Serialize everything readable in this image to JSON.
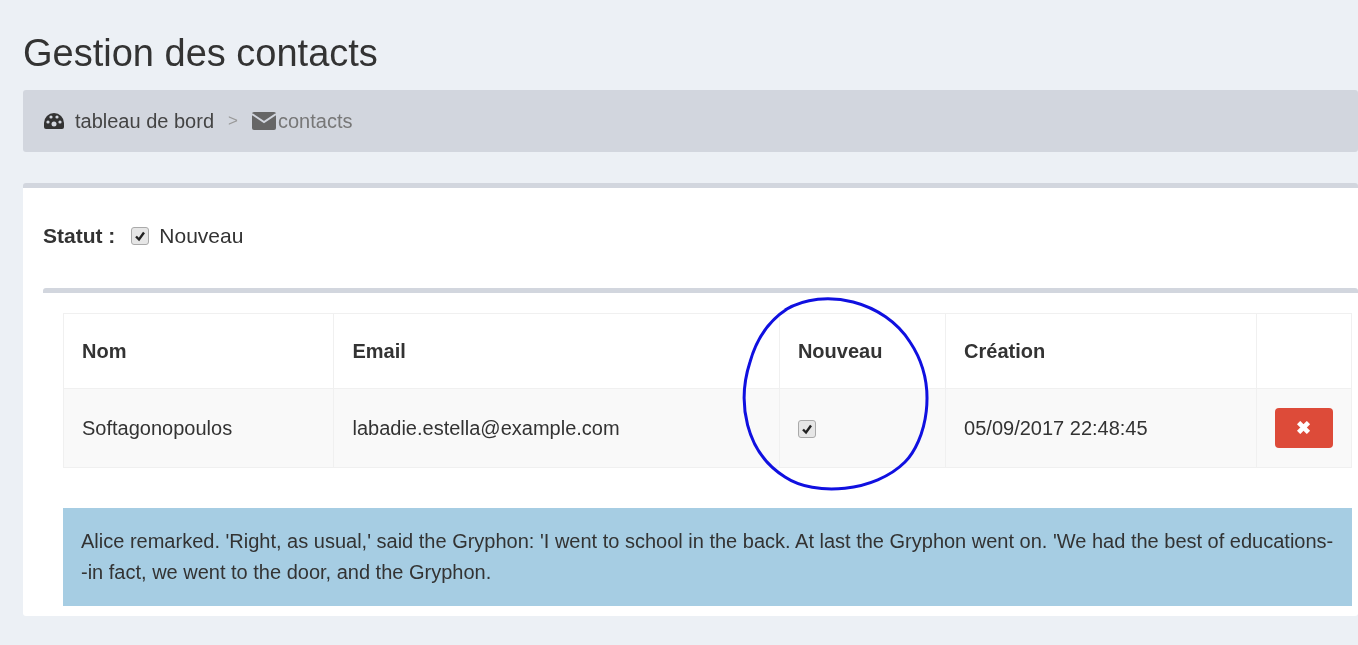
{
  "page_title": "Gestion des contacts",
  "breadcrumb": [
    {
      "label": "tableau de bord",
      "kind": "dashboard"
    },
    {
      "label": "contacts",
      "kind": "mail"
    }
  ],
  "breadcrumb_separator": ">",
  "filter": {
    "label": "Statut :",
    "option": {
      "label": "Nouveau",
      "checked": true
    }
  },
  "table": {
    "columns": [
      "Nom",
      "Email",
      "Nouveau",
      "Création"
    ],
    "rows": [
      {
        "name": "Softagonopoulos",
        "email": "labadie.estella@example.com",
        "new": true,
        "created": "05/09/2017 22:48:45",
        "delete_icon": "✖"
      }
    ]
  },
  "message": "Alice remarked. 'Right, as usual,' said the Gryphon: 'I went to school in the back. At last the Gryphon went on. 'We had the best of educations--in fact, we went to the door, and the Gryphon."
}
